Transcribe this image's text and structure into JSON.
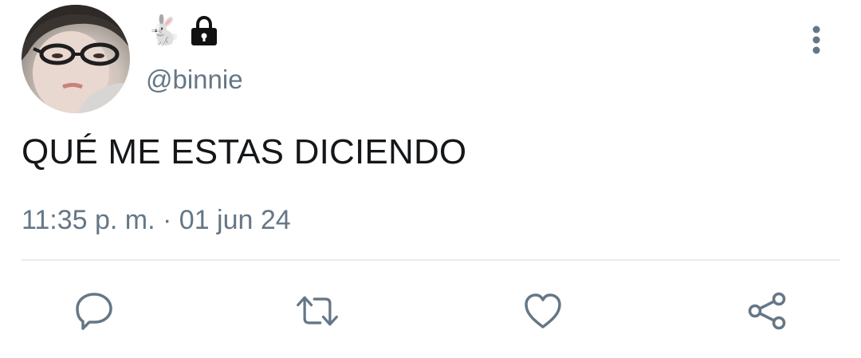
{
  "tweet": {
    "display_name_emoji": "🐇",
    "protected": true,
    "handle": "@binnie",
    "text": "QUÉ ME ESTAS DICIENDO",
    "time": "11:35 p. m.",
    "separator": " · ",
    "date": "01 jun 24"
  },
  "icons": {
    "avatar": "profile-photo",
    "lock": "lock-icon",
    "more": "more-vertical-icon",
    "reply": "reply-icon",
    "retweet": "retweet-icon",
    "like": "heart-icon",
    "share": "share-icon"
  },
  "colors": {
    "text_primary": "#14171a",
    "text_secondary": "#657786",
    "icon": "#657786",
    "divider": "#e6ecf0"
  }
}
